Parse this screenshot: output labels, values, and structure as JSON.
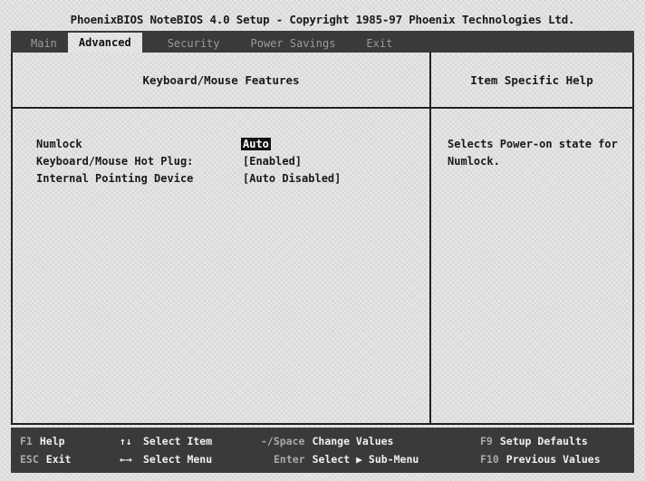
{
  "title": "PhoenixBIOS NoteBIOS 4.0 Setup - Copyright 1985-97 Phoenix Technologies Ltd.",
  "menu": {
    "tabs": [
      {
        "label": "Main",
        "active": false
      },
      {
        "label": "Advanced",
        "active": true
      },
      {
        "label": "Security",
        "active": false
      },
      {
        "label": "Power Savings",
        "active": false
      },
      {
        "label": "Exit",
        "active": false
      }
    ]
  },
  "left_panel": {
    "header": "Keyboard/Mouse Features",
    "settings": [
      {
        "label": "Numlock",
        "value": "Auto",
        "selected": true
      },
      {
        "label": "Keyboard/Mouse Hot Plug:",
        "value": "[Enabled]",
        "selected": false
      },
      {
        "label": "Internal Pointing Device",
        "value": "[Auto Disabled]",
        "selected": false
      }
    ]
  },
  "right_panel": {
    "header": "Item Specific Help",
    "help_text": "Selects Power-on state for Numlock."
  },
  "footer": {
    "f1": {
      "key": "F1",
      "label": "Help"
    },
    "esc": {
      "key": "ESC",
      "label": "Exit"
    },
    "updown": {
      "icon": "↑↓",
      "label": "Select Item"
    },
    "leftright": {
      "icon": "←→",
      "label": "Select Menu"
    },
    "minusplus": {
      "key": "-/Space",
      "label": "Change Values"
    },
    "enter": {
      "key": "Enter",
      "label": "Select ▶ Sub-Menu"
    },
    "f9": {
      "key": "F9",
      "label": "Setup Defaults"
    },
    "f10": {
      "key": "F10",
      "label": "Previous Values"
    }
  },
  "colors": {
    "background": "#e6e6e6",
    "bar": "#3a3a3a",
    "highlight": "#111111"
  }
}
